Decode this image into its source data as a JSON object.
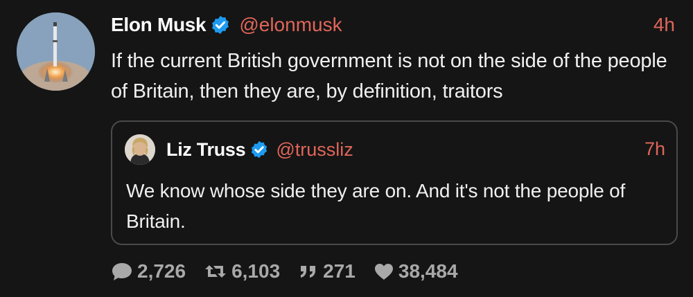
{
  "tweet": {
    "author": {
      "display_name": "Elon Musk",
      "handle": "@elonmusk",
      "verified": true,
      "avatar_icon": "rocket-launch-avatar"
    },
    "time": "4h",
    "text": "If the current British government is not on the side of the people of Britain, then they are, by definition, traitors"
  },
  "quote": {
    "author": {
      "display_name": "Liz Truss",
      "handle": "@trussliz",
      "verified": true,
      "avatar_icon": "person-portrait-avatar"
    },
    "time": "7h",
    "text": "We know whose side they are on. And it's not the people of Britain."
  },
  "actions": {
    "replies": "2,726",
    "retweets": "6,103",
    "quotes": "271",
    "likes": "38,484"
  },
  "colors": {
    "background": "#151515",
    "accent": "#e0665a",
    "verified": "#1d9bf0",
    "muted": "#a9a9a9"
  }
}
